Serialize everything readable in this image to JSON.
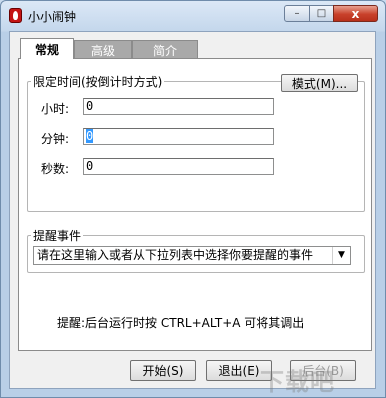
{
  "window": {
    "title": "小小闹钟"
  },
  "titlebar": {
    "minimize_glyph": "–",
    "maximize_glyph": "□",
    "close_glyph": "x"
  },
  "tabs": [
    {
      "label": "常规",
      "active": true
    },
    {
      "label": "高级",
      "active": false
    },
    {
      "label": "简介",
      "active": false
    }
  ],
  "timer_group": {
    "legend": "限定时间(按倒计时方式)",
    "mode_button": "模式(M)...",
    "fields": [
      {
        "label": "小时:",
        "value": "0"
      },
      {
        "label": "分钟:",
        "value": "0"
      },
      {
        "label": "秒数:",
        "value": "0"
      }
    ]
  },
  "reminder_group": {
    "legend": "提醒事件",
    "combo_value": "请在这里输入或者从下拉列表中选择你要提醒的事件"
  },
  "hint": "提醒:后台运行时按 CTRL+ALT+A 可将其调出",
  "buttons": {
    "start": "开始(S)",
    "exit": "退出(E)",
    "background": "后台(B)"
  },
  "watermark": "下载吧"
}
